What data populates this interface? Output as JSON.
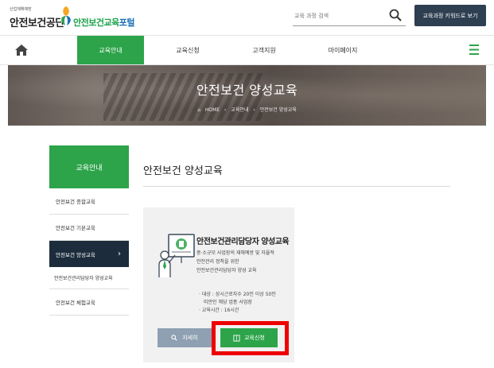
{
  "header": {
    "logo_org": "산업재해예방",
    "logo_main": "안전보건공단",
    "logo_sub_a": "안전보건교육",
    "logo_sub_b": "포털",
    "search_placeholder": "교육 과정 검색",
    "keyword_button": "교육과정 키워드로 보기"
  },
  "nav": {
    "items": [
      {
        "label": "교육안내",
        "active": true
      },
      {
        "label": "교육신청",
        "active": false
      },
      {
        "label": "고객지원",
        "active": false
      },
      {
        "label": "마이페이지",
        "active": false
      }
    ]
  },
  "banner": {
    "title": "안전보건 양성교육",
    "breadcrumb": [
      "HOME",
      "교육안내",
      "안전보건 양성교육"
    ]
  },
  "sidebar": {
    "heading": "교육안내",
    "items": [
      {
        "label": "안전보건 종합교육",
        "active": false
      },
      {
        "label": "안전보건 기본교육",
        "active": false
      },
      {
        "label": "안전보건 양성교육",
        "active": true
      }
    ],
    "sub_item": "안전보건관리담당자 양성교육",
    "last_item": "안전보건 체험교육"
  },
  "main": {
    "title": "안전보건 양성교육",
    "card": {
      "title": "안전보건관리담당자 양성교육",
      "desc": [
        "중·소규모 사업장의 재해예방 및 자율적",
        "안전관리 정착을 위한",
        "안전보건관리담당자 양성 교육"
      ],
      "meta": [
        "· 대상 : 상시근로자수 20인 이상 50인",
        "  미만인 해당 업종 사업장",
        "· 교육시간 : 16시간"
      ],
      "detail_button": "자세히",
      "apply_button": "교육신청"
    }
  },
  "colors": {
    "accent_green": "#2da44a",
    "dark_navy": "#1c2c3c",
    "highlight_red": "#ee0000"
  }
}
